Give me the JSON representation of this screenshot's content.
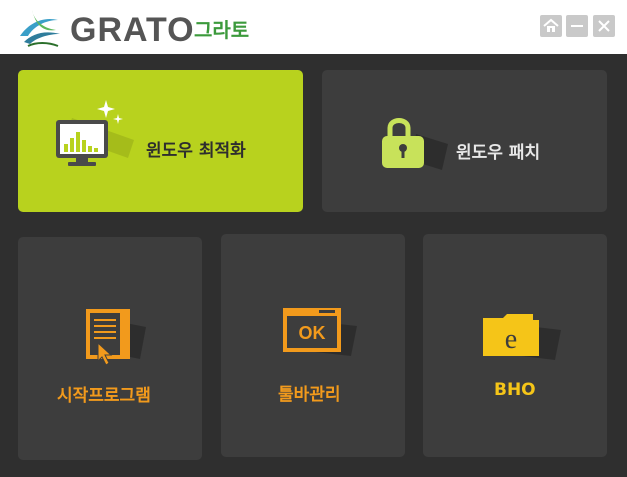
{
  "header": {
    "brand_text": "GRATO",
    "brand_korean": "그라토"
  },
  "window_controls": {
    "home_icon": "home-icon",
    "minimize_icon": "minimize-icon",
    "close_icon": "close-icon"
  },
  "tiles": [
    {
      "label": "윈도우 최적화",
      "icon": "monitor-equalizer-icon",
      "active": true
    },
    {
      "label": "윈도우 패치",
      "icon": "padlock-icon",
      "active": false
    },
    {
      "label": "시작프로그램",
      "icon": "document-cursor-icon",
      "active": false
    },
    {
      "label": "툴바관리",
      "icon": "ok-window-icon",
      "active": false,
      "badge": "OK"
    },
    {
      "label": "BHO",
      "icon": "folder-e-icon",
      "active": false,
      "badge": "e"
    }
  ],
  "colors": {
    "background": "#2f2f2f",
    "tile": "#3d3d3d",
    "active_tile": "#b8d21e",
    "orange": "#f29a1c",
    "yellow": "#f5c518",
    "brand_green": "#3c9a3c"
  }
}
